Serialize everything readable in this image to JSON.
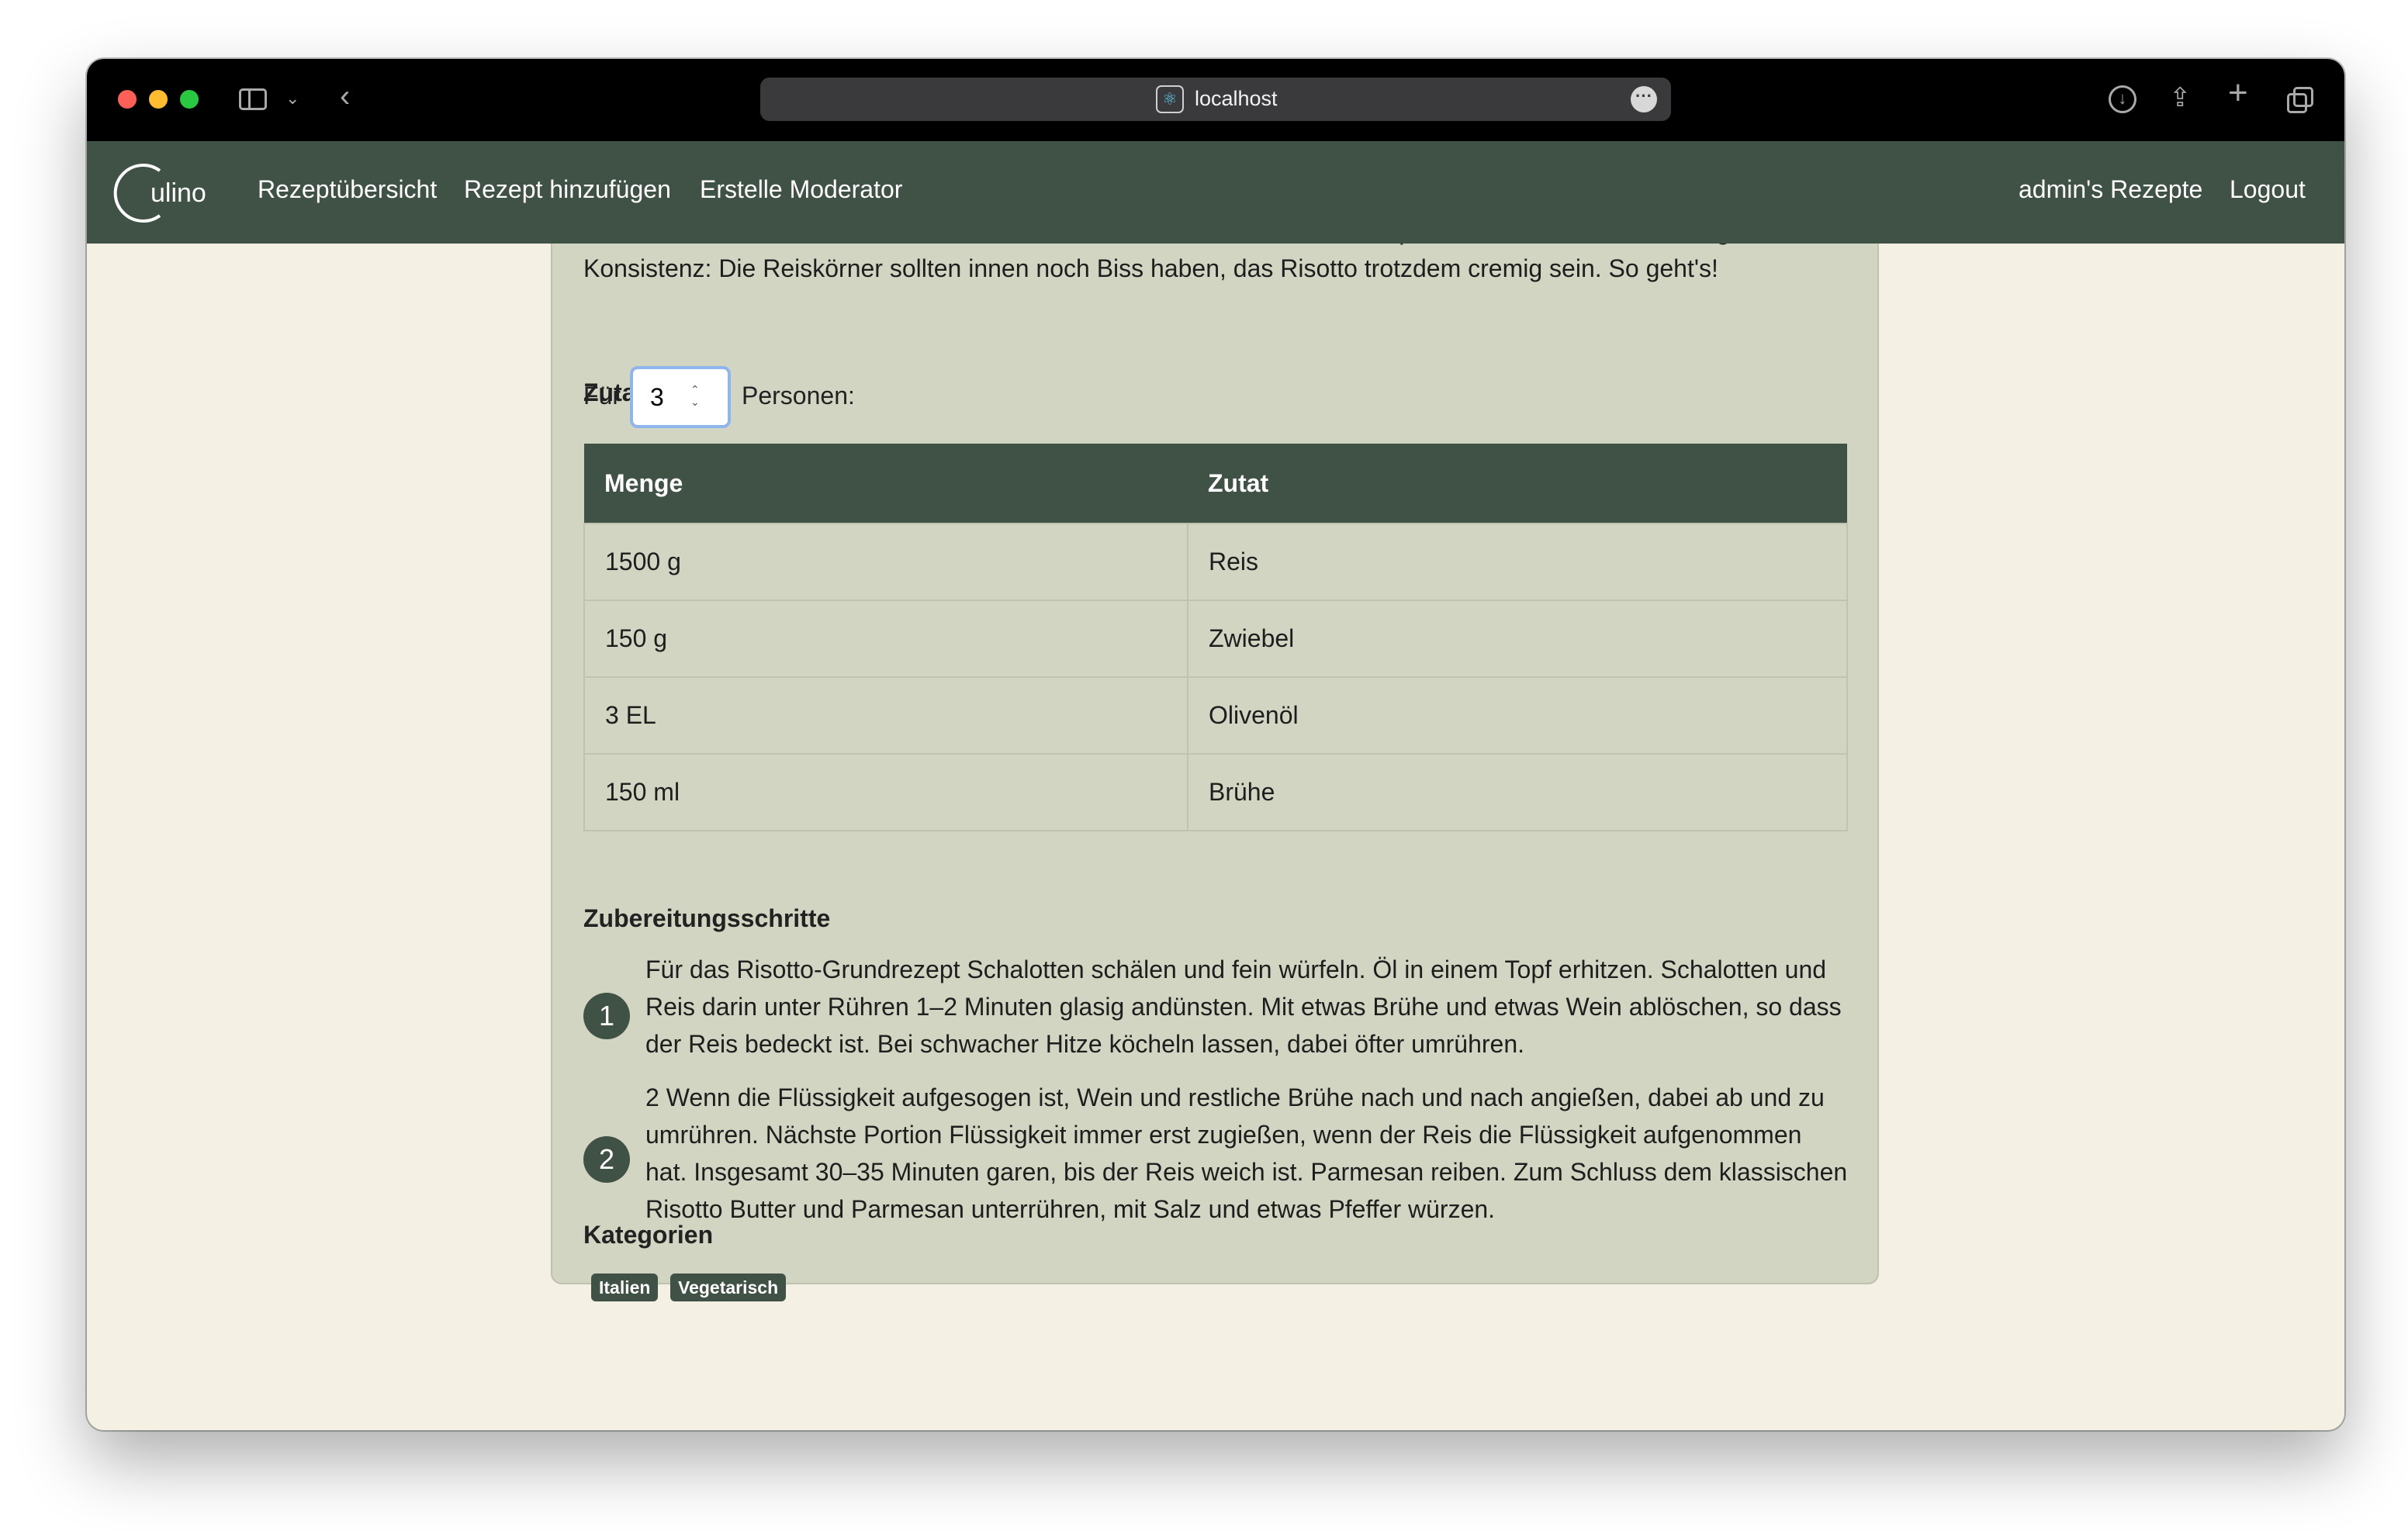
{
  "browser": {
    "url": "localhost",
    "favicon": "react-icon"
  },
  "nav": {
    "brand": "ulino",
    "links": [
      "Rezeptübersicht",
      "Rezept hinzufügen",
      "Erstelle Moderator"
    ],
    "right_links": [
      "admin's Rezepte",
      "Logout"
    ]
  },
  "recipe": {
    "intro_line_partial": "Risotto ist ein echter Klassiker der italienischen Küche und das Grundrezept ist denkbar einfach. Wichtig ist die",
    "intro_line_2": "Konsistenz: Die Reiskörner sollten innen noch Biss haben, das Risotto trotzdem cremig sein. So geht's!",
    "ingredients_title": "Zutatenliste",
    "servings_prefix": "Für",
    "servings_value": "3",
    "servings_suffix": "Personen:",
    "table_headers": [
      "Menge",
      "Zutat"
    ],
    "ingredients": [
      {
        "amount": "1500 g",
        "name": "Reis"
      },
      {
        "amount": "150 g",
        "name": "Zwiebel"
      },
      {
        "amount": "3 EL",
        "name": "Olivenöl"
      },
      {
        "amount": "150 ml",
        "name": "Brühe"
      }
    ],
    "steps_title": "Zubereitungsschritte",
    "steps": [
      {
        "number": "1",
        "text": "Für das Risotto-Grundrezept Schalotten schälen und fein würfeln. Öl in einem Topf erhitzen. Schalotten und Reis darin unter Rühren 1–2 Minuten glasig andünsten. Mit etwas Brühe und etwas Wein ablöschen, so dass der Reis bedeckt ist. Bei schwacher Hitze köcheln lassen, dabei öfter umrühren."
      },
      {
        "number": "2",
        "text": "2 Wenn die Flüssigkeit aufgesogen ist, Wein und restliche Brühe nach und nach angießen, dabei ab und zu umrühren. Nächste Portion Flüssigkeit immer erst zugießen, wenn der Reis die Flüssigkeit aufgenommen hat. Insgesamt 30–35 Minuten garen, bis der Reis weich ist. Parmesan reiben. Zum Schluss dem klassischen Risotto Butter und Parmesan unterrühren, mit Salz und etwas Pfeffer würzen."
      }
    ],
    "categories_title": "Kategorien",
    "categories": [
      "Italien",
      "Vegetarisch"
    ]
  },
  "colors": {
    "header": "#3f5245",
    "page_bg": "#f4f0e4",
    "card_bg": "#d2d5c1"
  }
}
